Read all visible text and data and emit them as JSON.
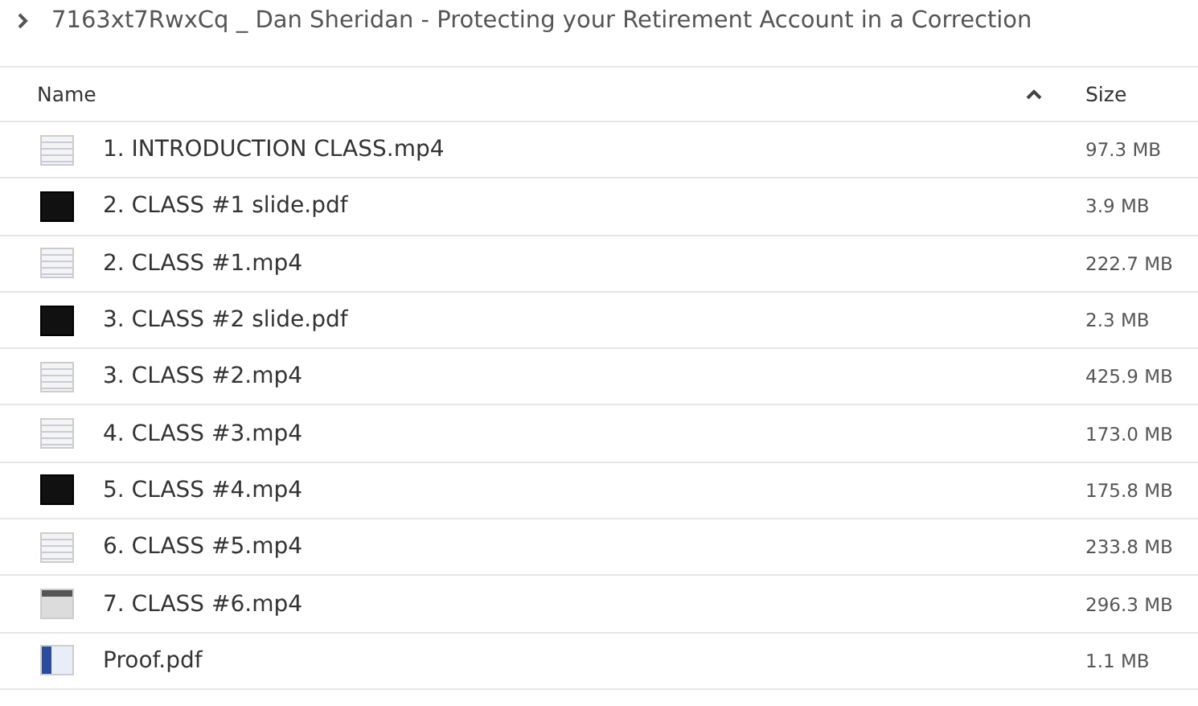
{
  "breadcrumb": {
    "path": "7163xt7RwxCq _ Dan Sheridan - Protecting your Retirement Account in a Correction"
  },
  "table": {
    "columns": [
      {
        "label": "Name",
        "sorted": true
      },
      {
        "label": "Size",
        "sorted": false
      }
    ],
    "rows": [
      {
        "name": "1. INTRODUCTION CLASS.mp4",
        "size": "97.3 MB",
        "kind": "light"
      },
      {
        "name": "2. CLASS #1 slide.pdf",
        "size": "3.9 MB",
        "kind": "dark"
      },
      {
        "name": "2. CLASS #1.mp4",
        "size": "222.7 MB",
        "kind": "light"
      },
      {
        "name": "3. CLASS #2 slide.pdf",
        "size": "2.3 MB",
        "kind": "dark"
      },
      {
        "name": "3. CLASS #2.mp4",
        "size": "425.9 MB",
        "kind": "light"
      },
      {
        "name": "4. CLASS #3.mp4",
        "size": "173.0 MB",
        "kind": "light"
      },
      {
        "name": "5. CLASS #4.mp4",
        "size": "175.8 MB",
        "kind": "dark"
      },
      {
        "name": "6. CLASS #5.mp4",
        "size": "233.8 MB",
        "kind": "light"
      },
      {
        "name": "7. CLASS #6.mp4",
        "size": "296.3 MB",
        "kind": "grey"
      },
      {
        "name": "Proof.pdf",
        "size": "1.1 MB",
        "kind": "blue"
      }
    ]
  }
}
